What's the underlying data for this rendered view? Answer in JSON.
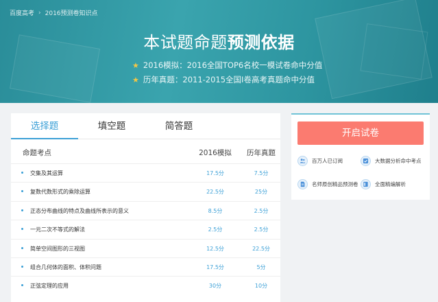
{
  "breadcrumb": {
    "home": "百度高考",
    "current": "2016预测卷知识点"
  },
  "hero": {
    "title_normal": "本试题命题",
    "title_bold": "预测依据",
    "lines": [
      "2016模拟：2016全国TOP6名校一模试卷命中分值",
      "历年真题：2011-2015全国I卷高考真题命中分值"
    ],
    "accent_color": "#2d95a0"
  },
  "tabs": [
    {
      "label": "选择题",
      "active": true
    },
    {
      "label": "填空题",
      "active": false
    },
    {
      "label": "简答题",
      "active": false
    }
  ],
  "table": {
    "headers": [
      "命题考点",
      "2016模拟",
      "历年真题"
    ],
    "rows": [
      {
        "topic": "交集及其运算",
        "mock": "17.5分",
        "real": "7.5分"
      },
      {
        "topic": "复数代数形式的乘除运算",
        "mock": "22.5分",
        "real": "25分"
      },
      {
        "topic": "正态分布曲线的特点及曲线所表示的意义",
        "mock": "8.5分",
        "real": "2.5分"
      },
      {
        "topic": "一元二次不等式的解法",
        "mock": "2.5分",
        "real": "2.5分"
      },
      {
        "topic": "简单空间图形的三视图",
        "mock": "12.5分",
        "real": "22.5分"
      },
      {
        "topic": "组合几何体的面积、体积问题",
        "mock": "17.5分",
        "real": "5分"
      },
      {
        "topic": "正弦定理的应用",
        "mock": "30分",
        "real": "10分"
      }
    ],
    "value_color": "#3a9fd6"
  },
  "side": {
    "start_button": "开启试卷",
    "button_color": "#fb7b70",
    "features": [
      {
        "icon": "users-icon",
        "label": "百万人已订阅"
      },
      {
        "icon": "check-icon",
        "label": "大数据分析命中考点"
      },
      {
        "icon": "document-icon",
        "label": "名师原创精品预测卷"
      },
      {
        "icon": "book-icon",
        "label": "全面精编解析"
      }
    ]
  }
}
